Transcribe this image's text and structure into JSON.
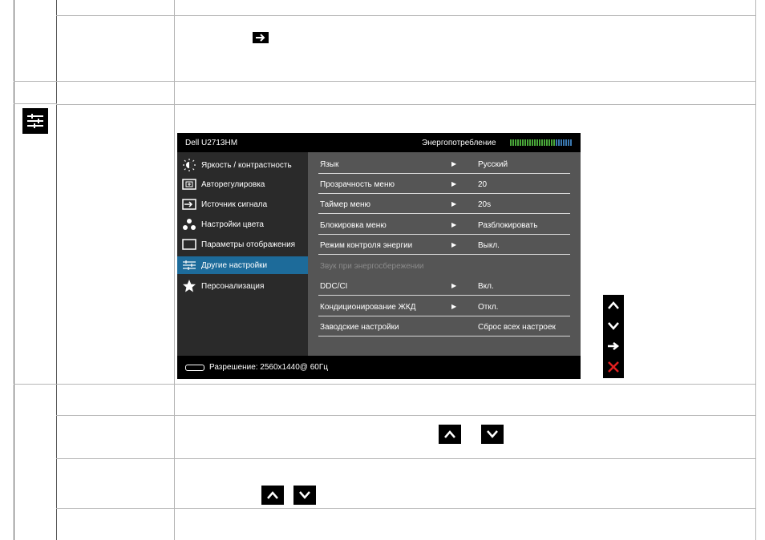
{
  "osd": {
    "model": "Dell U2713HM",
    "energy_label": "Энергопотребление",
    "energy_meter_level": 0.72,
    "left_menu": [
      {
        "label": "Яркость / контрастность",
        "icon": "brightness-icon",
        "selected": false
      },
      {
        "label": "Авторегулировка",
        "icon": "auto-adjust-icon",
        "selected": false
      },
      {
        "label": "Источник сигнала",
        "icon": "input-source-icon",
        "selected": false
      },
      {
        "label": "Настройки цвета",
        "icon": "color-settings-icon",
        "selected": false
      },
      {
        "label": "Параметры отображения",
        "icon": "display-settings-icon",
        "selected": false
      },
      {
        "label": "Другие настройки",
        "icon": "other-settings-icon",
        "selected": true
      },
      {
        "label": "Персонализация",
        "icon": "star-icon",
        "selected": false
      }
    ],
    "right_rows": [
      {
        "label": "Язык",
        "arrow": "▶",
        "value": "Русский",
        "disabled": false
      },
      {
        "label": "Прозрачность меню",
        "arrow": "▶",
        "value": "20",
        "disabled": false
      },
      {
        "label": "Таймер меню",
        "arrow": "▶",
        "value": "20s",
        "disabled": false
      },
      {
        "label": "Блокировка меню",
        "arrow": "▶",
        "value": "Разблокировать",
        "disabled": false
      },
      {
        "label": "Режим контроля энергии",
        "arrow": "▶",
        "value": "Выкл.",
        "disabled": false
      },
      {
        "label": "Звук при энергосбережении",
        "arrow": "",
        "value": "",
        "disabled": true
      },
      {
        "label": "DDC/CI",
        "arrow": "▶",
        "value": "Вкл.",
        "disabled": false
      },
      {
        "label": "Кондиционирование ЖКД",
        "arrow": "▶",
        "value": "Откл.",
        "disabled": false
      },
      {
        "label": "Заводские настройки",
        "arrow": "",
        "value": "Сброс всех настроек",
        "disabled": false
      }
    ],
    "footer": "Разрешение: 2560x1440@ 60Гц"
  },
  "nav_buttons": [
    "up-icon",
    "down-icon",
    "enter-icon",
    "exit-icon"
  ],
  "colors": {
    "selected": "#1d6b9a",
    "exit": "#e02020",
    "meter_on": "#4aa83a",
    "meter_off": "#3a78b0"
  }
}
